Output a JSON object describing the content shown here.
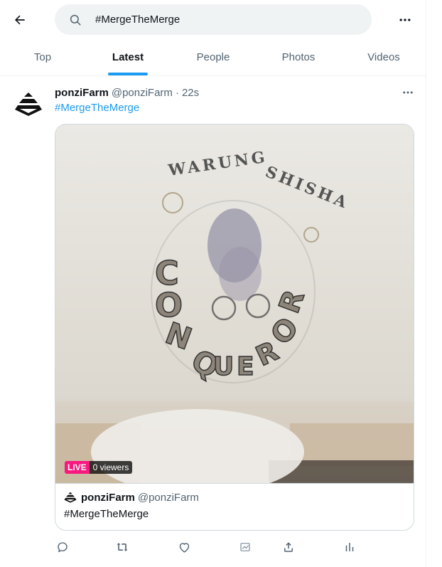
{
  "header": {
    "back_icon": "arrow-left-icon",
    "search": {
      "value": "#MergeTheMerge",
      "icon": "search-icon"
    },
    "more_icon": "more-horizontal-icon"
  },
  "tabs": [
    {
      "label": "Top",
      "active": false
    },
    {
      "label": "Latest",
      "active": true
    },
    {
      "label": "People",
      "active": false
    },
    {
      "label": "Photos",
      "active": false
    },
    {
      "label": "Videos",
      "active": false
    }
  ],
  "tweet": {
    "display_name": "ponziFarm",
    "handle": "@ponziFarm",
    "separator": "·",
    "time": "22s",
    "hashtag": "#MergeTheMerge",
    "avatar_icon": "pyramid-logo-icon",
    "video": {
      "scene_text": "WARUNG SHISHA CONQUEROR",
      "live_label": "LIVE",
      "viewers": "0 viewers"
    },
    "card": {
      "display_name": "ponziFarm",
      "handle": "@ponziFarm",
      "text": "#MergeTheMerge"
    },
    "actions": [
      "reply-icon",
      "retweet-icon",
      "like-icon",
      "broadcast-icon",
      "share-icon",
      "analytics-icon"
    ]
  },
  "colors": {
    "accent": "#1d9bf0",
    "live": "#f91880",
    "muted": "#536471"
  }
}
